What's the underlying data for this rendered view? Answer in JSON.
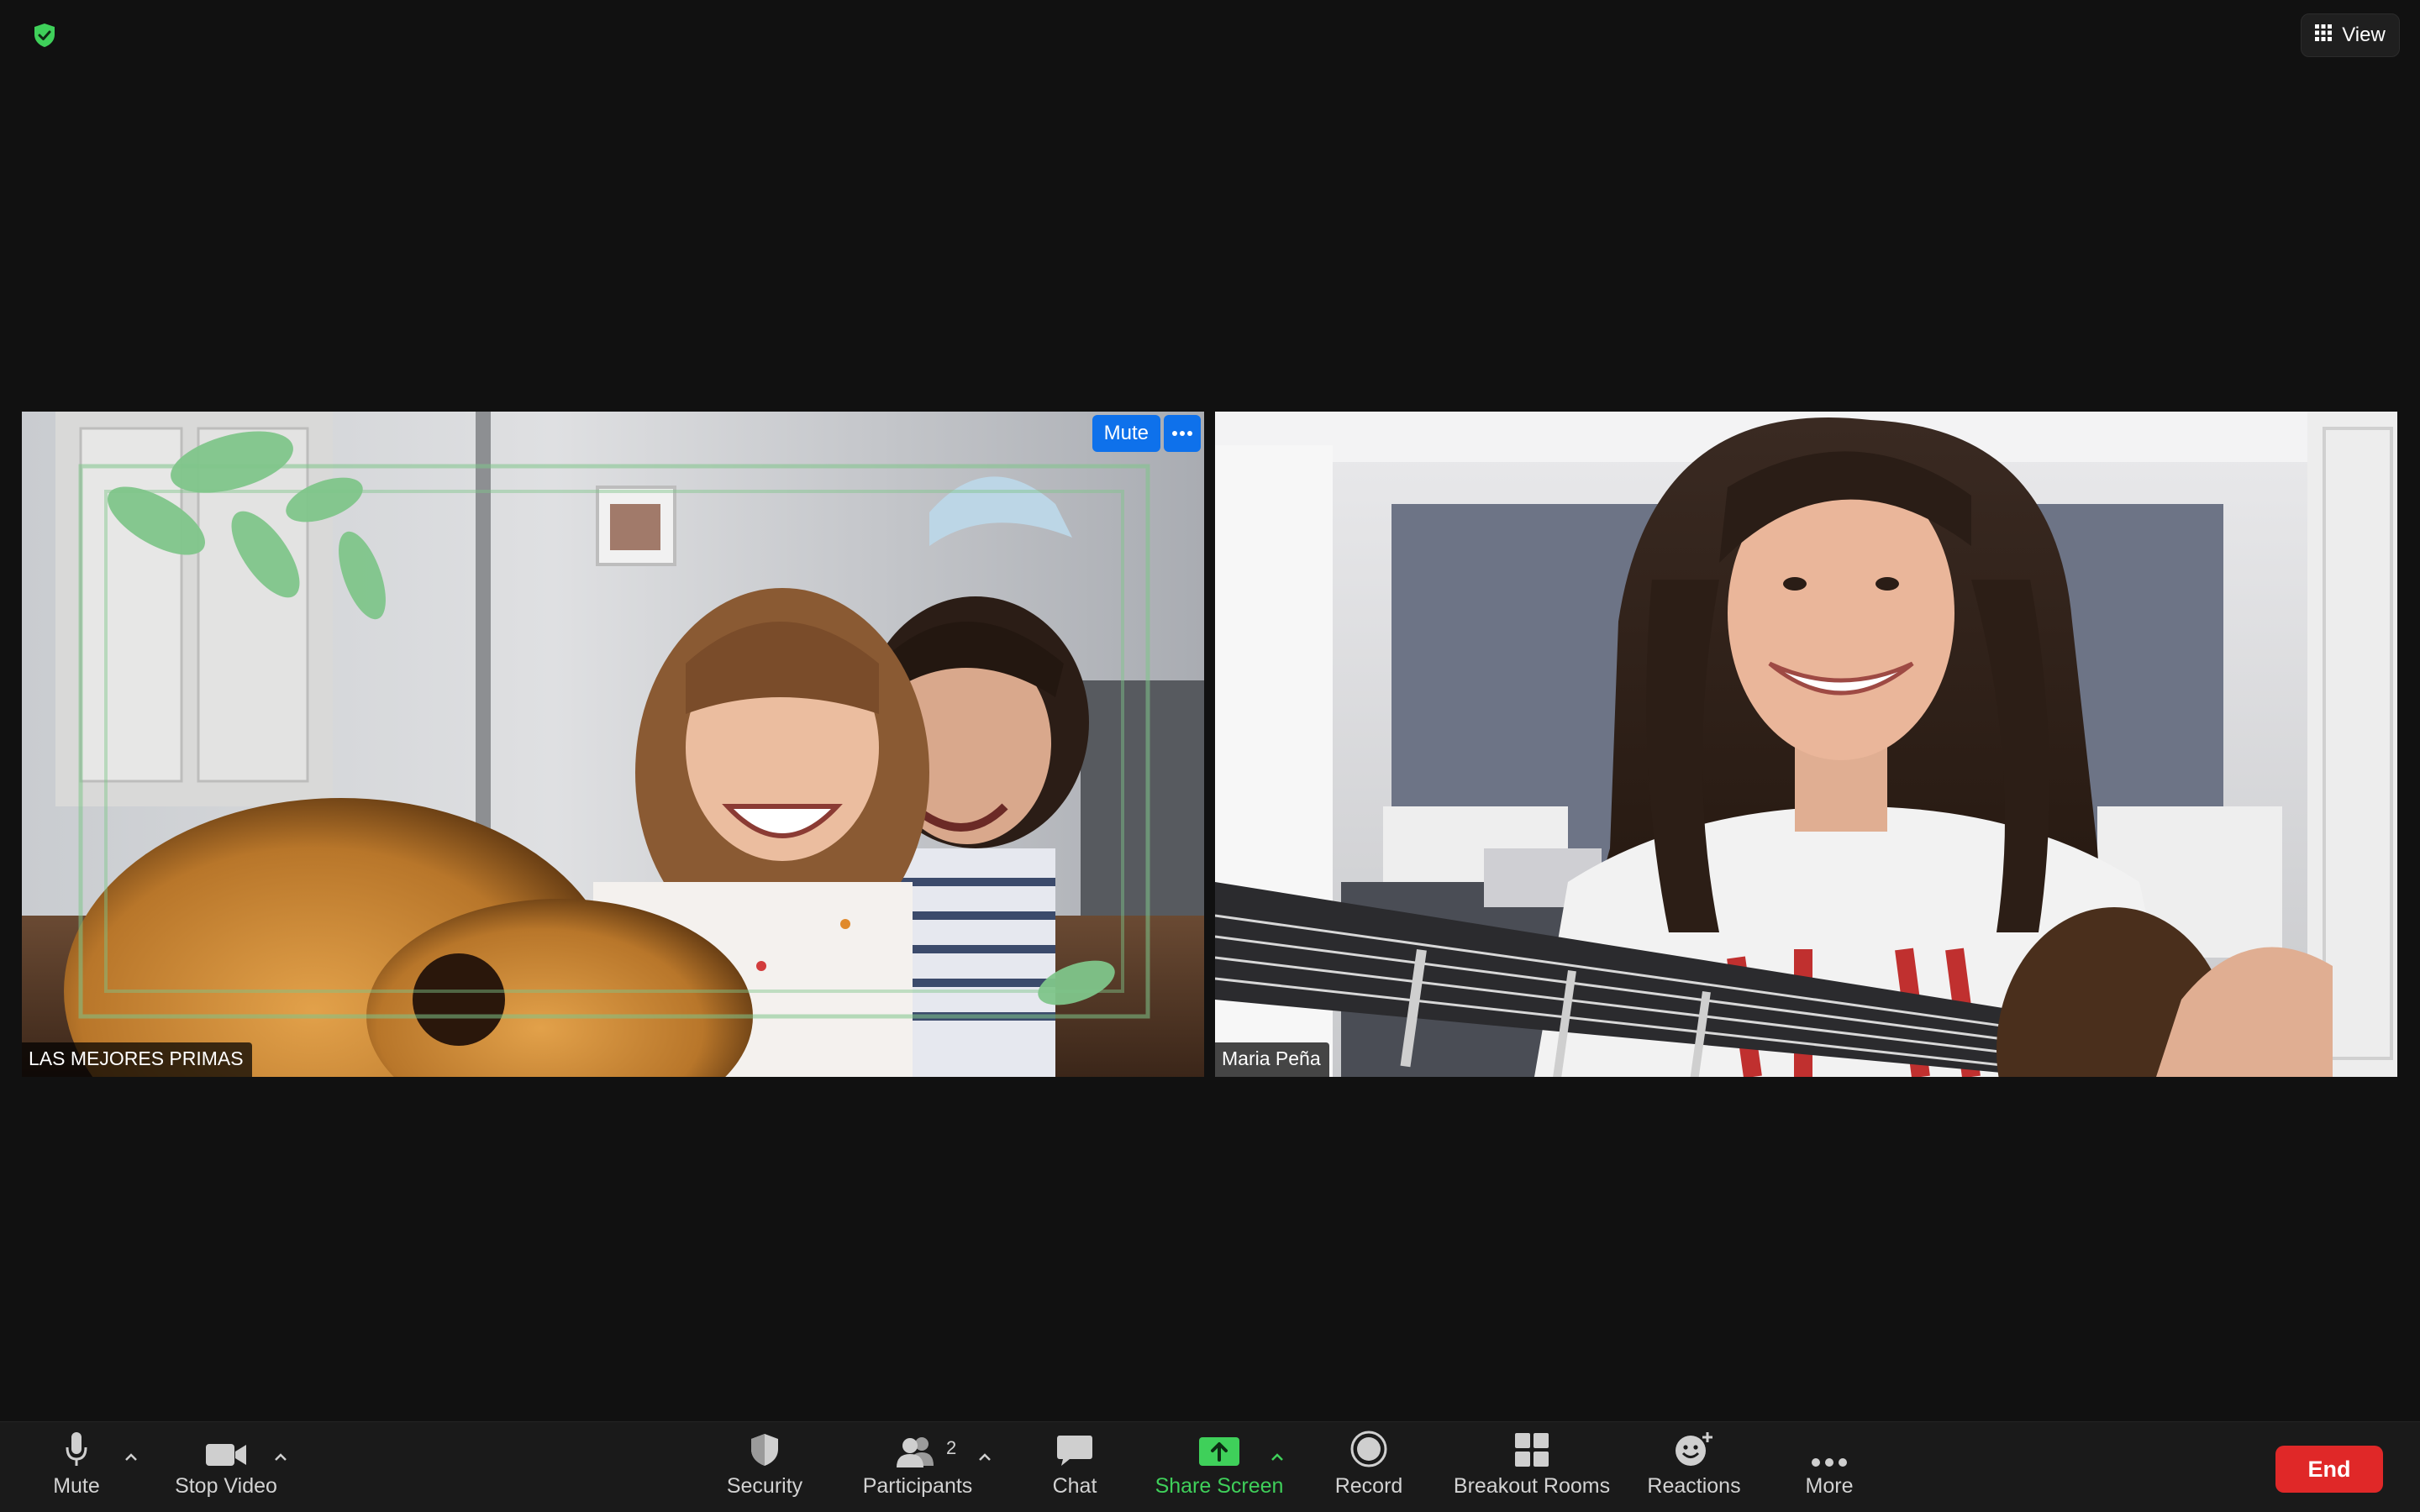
{
  "top": {
    "view_label": "View"
  },
  "tiles": [
    {
      "name": "LAS MEJORES PRIMAS",
      "mute_label": "Mute"
    },
    {
      "name": "Maria Peña"
    }
  ],
  "toolbar": {
    "mute": "Mute",
    "stop_video": "Stop Video",
    "security": "Security",
    "participants": "Participants",
    "participants_count": "2",
    "chat": "Chat",
    "share_screen": "Share Screen",
    "record": "Record",
    "breakout_rooms": "Breakout Rooms",
    "reactions": "Reactions",
    "more": "More",
    "end": "End"
  },
  "colors": {
    "background": "#111111",
    "accent_blue": "#0e71eb",
    "share_green": "#3fd05a",
    "end_red": "#e02828"
  },
  "icons": [
    "shield-check-icon",
    "grid-icon",
    "microphone-icon",
    "video-camera-icon",
    "shield-icon",
    "participants-icon",
    "chat-bubble-icon",
    "share-screen-icon",
    "record-icon",
    "breakout-rooms-icon",
    "reactions-icon",
    "more-dots-icon",
    "caret-up-icon"
  ]
}
